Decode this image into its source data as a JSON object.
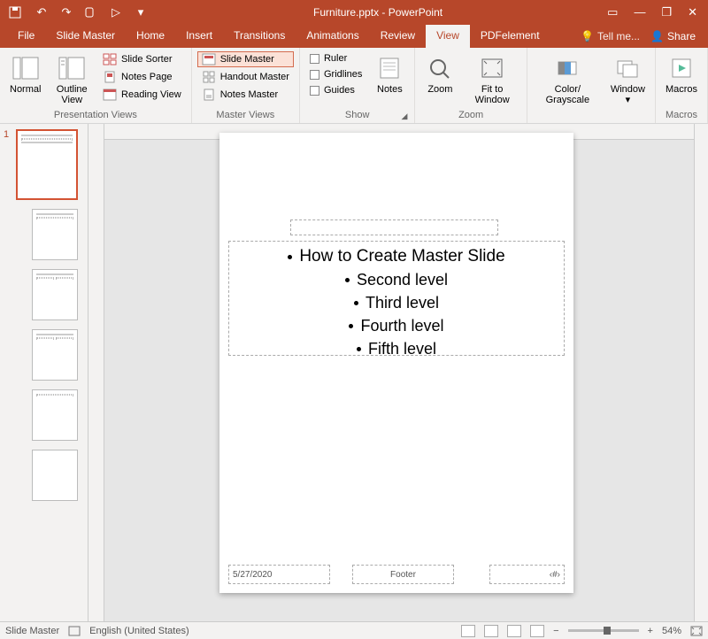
{
  "title": "Furniture.pptx - PowerPoint",
  "qat": {
    "save": "",
    "undo": "↶",
    "redo": "↷",
    "tool": "",
    "start": "▷",
    "more": "▾"
  },
  "window": {
    "opts": "▭",
    "min": "—",
    "restore": "❐",
    "close": "✕"
  },
  "tabs": [
    "File",
    "Slide Master",
    "Home",
    "Insert",
    "Transitions",
    "Animations",
    "Review",
    "View",
    "PDFelement"
  ],
  "active_tab": "View",
  "tell_me": "Tell me...",
  "share": "Share",
  "ribbon": {
    "presentation_views": {
      "normal": "Normal",
      "outline": "Outline View",
      "sorter": "Slide Sorter",
      "notespage": "Notes Page",
      "reading": "Reading View",
      "label": "Presentation Views"
    },
    "master_views": {
      "slide": "Slide Master",
      "handout": "Handout Master",
      "notes": "Notes Master",
      "label": "Master Views"
    },
    "show": {
      "ruler": "Ruler",
      "gridlines": "Gridlines",
      "guides": "Guides",
      "notes": "Notes",
      "label": "Show"
    },
    "zoom": {
      "zoom": "Zoom",
      "fit": "Fit to Window",
      "label": "Zoom"
    },
    "color": {
      "color": "Color/ Grayscale",
      "window": "Window",
      "label": ""
    },
    "macros": {
      "macros": "Macros",
      "label": "Macros"
    }
  },
  "master_num": "1",
  "content": {
    "l1": "How to Create Master Slide",
    "l2": "Second level",
    "l3": "Third level",
    "l4": "Fourth level",
    "l5": "Fifth level"
  },
  "footer": {
    "date": "5/27/2020",
    "footer": "Footer",
    "num": "‹#›"
  },
  "status": {
    "view": "Slide Master",
    "lang": "English (United States)",
    "zoom": "54%"
  }
}
